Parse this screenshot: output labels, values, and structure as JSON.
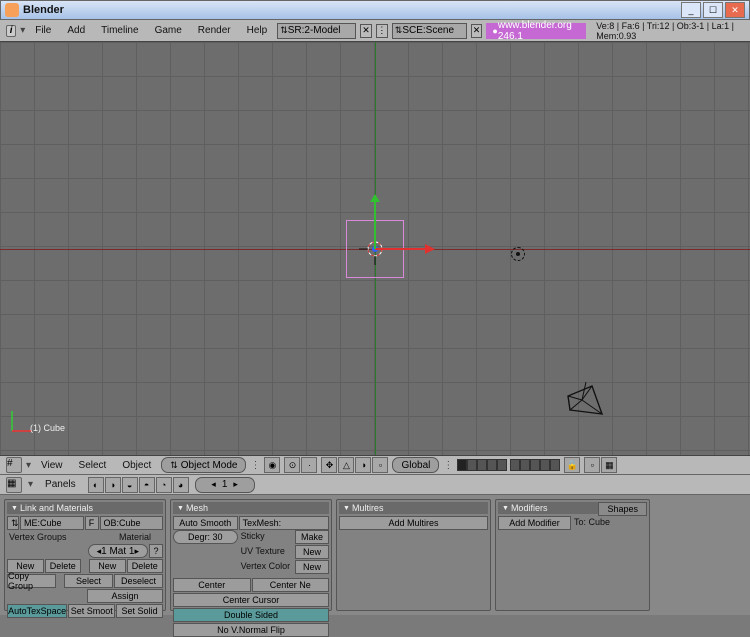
{
  "window": {
    "title": "Blender"
  },
  "topmenu": {
    "items": [
      "File",
      "Add",
      "Timeline",
      "Game",
      "Render",
      "Help"
    ],
    "screen_sel": "SR:2-Model",
    "scene_sel": "SCE:Scene",
    "url": "www.blender.org  246.1",
    "stats": "Ve:8 | Fa:6 | Tri:12 | Ob:3-1 | La:1 | Mem:0.93"
  },
  "viewport": {
    "object_label": "(1) Cube"
  },
  "header3d": {
    "menus": [
      "View",
      "Select",
      "Object"
    ],
    "mode": "Object Mode",
    "orient": "Global"
  },
  "header_buttons": {
    "panels_label": "Panels",
    "page": "1"
  },
  "panels": {
    "link_materials": {
      "title": "Link and Materials",
      "me": "ME:Cube",
      "f": "F",
      "ob": "OB:Cube",
      "vertex_groups": "Vertex Groups",
      "material": "Material",
      "mat_spinner": "1 Mat 1",
      "mat_q": "?",
      "new": "New",
      "delete": "Delete",
      "copy_group": "Copy Group",
      "select": "Select",
      "deselect": "Deselect",
      "assign": "Assign",
      "autotexspace": "AutoTexSpace",
      "set_smooth": "Set Smoot",
      "set_solid": "Set Solid"
    },
    "mesh": {
      "title": "Mesh",
      "auto_smooth": "Auto Smooth",
      "degr": "Degr: 30",
      "texmesh": "TexMesh:",
      "sticky": "Sticky",
      "uv": "UV Texture",
      "vcol": "Vertex Color",
      "make": "Make",
      "new": "New",
      "center": "Center",
      "center_new": "Center Ne",
      "center_cursor": "Center Cursor",
      "double_sided": "Double Sided",
      "no_vnflip": "No V.Normal Flip"
    },
    "multires": {
      "title": "Multires",
      "add": "Add Multires"
    },
    "modifiers": {
      "title": "Modifiers",
      "shapes_tab": "Shapes",
      "add": "Add Modifier",
      "to": "To: Cube"
    }
  }
}
